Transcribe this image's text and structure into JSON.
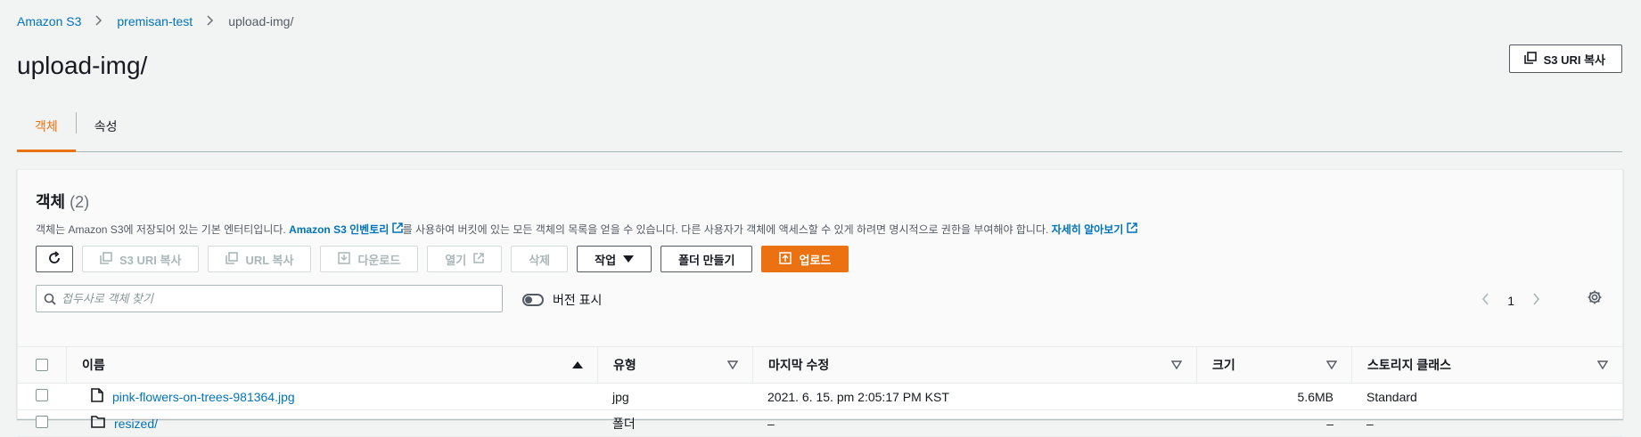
{
  "breadcrumb": {
    "items": [
      "Amazon S3",
      "premisan-test",
      "upload-img/"
    ]
  },
  "page": {
    "title": "upload-img/",
    "copy_uri_label": "S3 URI 복사"
  },
  "tabs": [
    {
      "label": "객체",
      "active": true
    },
    {
      "label": "속성",
      "active": false
    }
  ],
  "panel": {
    "title": "객체",
    "count": "(2)",
    "desc_prefix": "객체는 Amazon S3에 저장되어 있는 기본 엔터티입니다. ",
    "desc_link": "Amazon S3 인벤토리",
    "desc_middle": "를 사용하여 버킷에 있는 모든 객체의 목록을 얻을 수 있습니다. 다른 사용자가 객체에 액세스할 수 있게 하려면 명시적으로 권한을 부여해야 합니다. ",
    "desc_learn_more": "자세히 알아보기"
  },
  "toolbar": {
    "copy_s3_uri": "S3 URI 복사",
    "copy_url": "URL 복사",
    "download": "다운로드",
    "open": "열기",
    "delete": "삭제",
    "actions": "작업",
    "create_folder": "폴더 만들기",
    "upload": "업로드"
  },
  "search": {
    "placeholder": "접두사로 객체 찾기"
  },
  "versions_toggle": {
    "label": "버전 표시",
    "on": false
  },
  "pagination": {
    "page": "1"
  },
  "table": {
    "columns": [
      "이름",
      "유형",
      "마지막 수정",
      "크기",
      "스토리지 클래스"
    ],
    "rows": [
      {
        "name": "pink-flowers-on-trees-981364.jpg",
        "type": "jpg",
        "modified": "2021. 6. 15. pm 2:05:17 PM KST",
        "size": "5.6MB",
        "storage": "Standard",
        "icon": "file-icon"
      },
      {
        "name": "resized/",
        "type": "폴더",
        "modified": "–",
        "size": "–",
        "storage": "–",
        "icon": "folder-icon"
      }
    ]
  },
  "colors": {
    "accent": "#ec7211",
    "link": "#0073bb",
    "background": "#f2f3f3"
  }
}
